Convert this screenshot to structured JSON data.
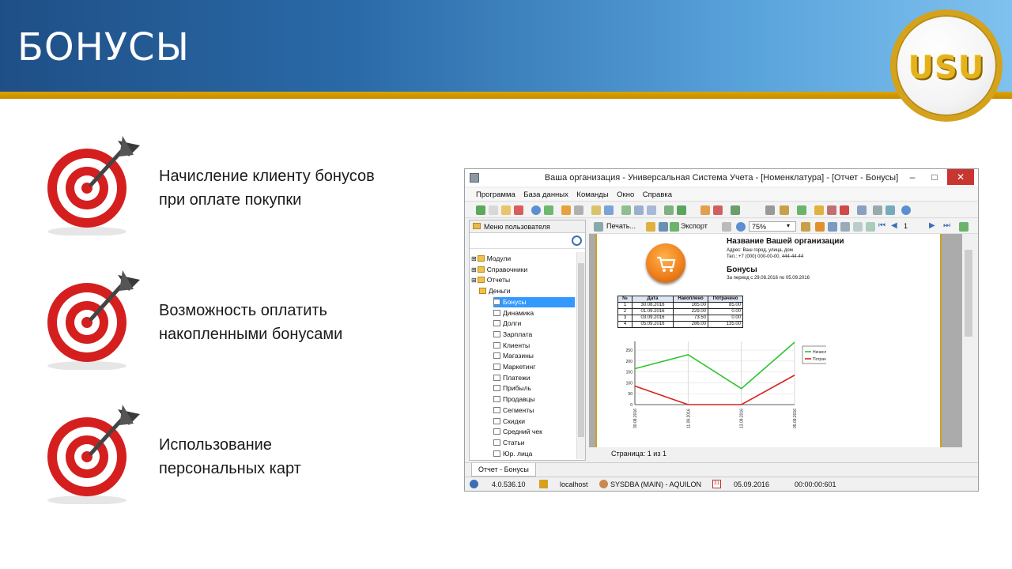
{
  "slide": {
    "title": "БОНУСЫ",
    "logo_text": "USU",
    "bullets": [
      {
        "text": "Начисление клиенту бонусов\nпри оплате покупки"
      },
      {
        "text": "Возможность оплатить\nнакопленными бонусами"
      },
      {
        "text": "Использование\nперсональных карт"
      }
    ]
  },
  "window": {
    "title": "Ваша организация - Универсальная Система Учета - [Номенклатура] - [Отчет - Бонусы]",
    "menu": [
      "Программа",
      "База данных",
      "Команды",
      "Окно",
      "Справка"
    ],
    "print_label": "Печать...",
    "export_label": "Экспорт",
    "zoom": "75%",
    "page_input": "1",
    "left_panel": {
      "header": "Меню пользователя",
      "tree": [
        {
          "label": "Модули",
          "level": 0,
          "icon": "folder"
        },
        {
          "label": "Справочники",
          "level": 0,
          "icon": "folder"
        },
        {
          "label": "Отчеты",
          "level": 0,
          "icon": "folder"
        },
        {
          "label": "Деньги",
          "level": 1,
          "icon": "folder"
        },
        {
          "label": "Бонусы",
          "level": 2,
          "icon": "doc",
          "selected": true
        },
        {
          "label": "Динамика",
          "level": 2,
          "icon": "doc"
        },
        {
          "label": "Долги",
          "level": 2,
          "icon": "doc"
        },
        {
          "label": "Зарплата",
          "level": 2,
          "icon": "doc"
        },
        {
          "label": "Клиенты",
          "level": 2,
          "icon": "doc"
        },
        {
          "label": "Магазины",
          "level": 2,
          "icon": "doc"
        },
        {
          "label": "Маркетинг",
          "level": 2,
          "icon": "doc"
        },
        {
          "label": "Платежи",
          "level": 2,
          "icon": "doc"
        },
        {
          "label": "Прибыль",
          "level": 2,
          "icon": "doc"
        },
        {
          "label": "Продавцы",
          "level": 2,
          "icon": "doc"
        },
        {
          "label": "Сегменты",
          "level": 2,
          "icon": "doc"
        },
        {
          "label": "Скидки",
          "level": 2,
          "icon": "doc"
        },
        {
          "label": "Средний чек",
          "level": 2,
          "icon": "doc"
        },
        {
          "label": "Статьи",
          "level": 2,
          "icon": "doc"
        },
        {
          "label": "Юр. лица",
          "level": 2,
          "icon": "doc"
        }
      ]
    },
    "report": {
      "org_name": "Название Вашей организации",
      "address": "Адрес: Ваш город, улица, дом",
      "phone": "Тел.: +7 (000) 000-00-00, 444-44-44",
      "report_title": "Бонусы",
      "period": "За период с 29.08.2016 по 05.09.2016",
      "table": {
        "headers": [
          "№",
          "Дата",
          "Накоплено",
          "Потрачено"
        ],
        "rows": [
          [
            "1",
            "30.08.2016",
            "165.00",
            "85.00"
          ],
          [
            "2",
            "01.09.2016",
            "229.00",
            "0.00"
          ],
          [
            "3",
            "03.09.2016",
            "73.50",
            "0.00"
          ],
          [
            "4",
            "05.09.2016",
            "286.00",
            "135.00"
          ]
        ]
      }
    },
    "chart_data": {
      "type": "line",
      "categories": [
        "30.08.2016",
        "01.09.2016",
        "03.09.2016",
        "05.09.2016"
      ],
      "series": [
        {
          "name": "Начислено",
          "values": [
            165,
            229,
            73.5,
            286
          ],
          "color": "#2ec52e"
        },
        {
          "name": "Потрачено",
          "values": [
            85,
            0,
            0,
            135
          ],
          "color": "#d9231f"
        }
      ],
      "yticks": [
        0,
        50,
        100,
        150,
        200,
        250
      ],
      "xtick_labels": [
        "30.08.2016",
        "11.09.2016",
        "13.09.2016",
        "05.09.2016"
      ],
      "ylim": [
        0,
        290
      ],
      "grid": true,
      "legend": "right"
    },
    "page_status": "Страница: 1 из 1",
    "tab": "Отчет - Бонусы",
    "status": {
      "version": "4.0.536.10",
      "server": "localhost",
      "user": "SYSDBA (MAIN) - AQUILON",
      "calendar_day": "31",
      "date": "05.09.2016",
      "timer": "00:00:00:601"
    }
  }
}
